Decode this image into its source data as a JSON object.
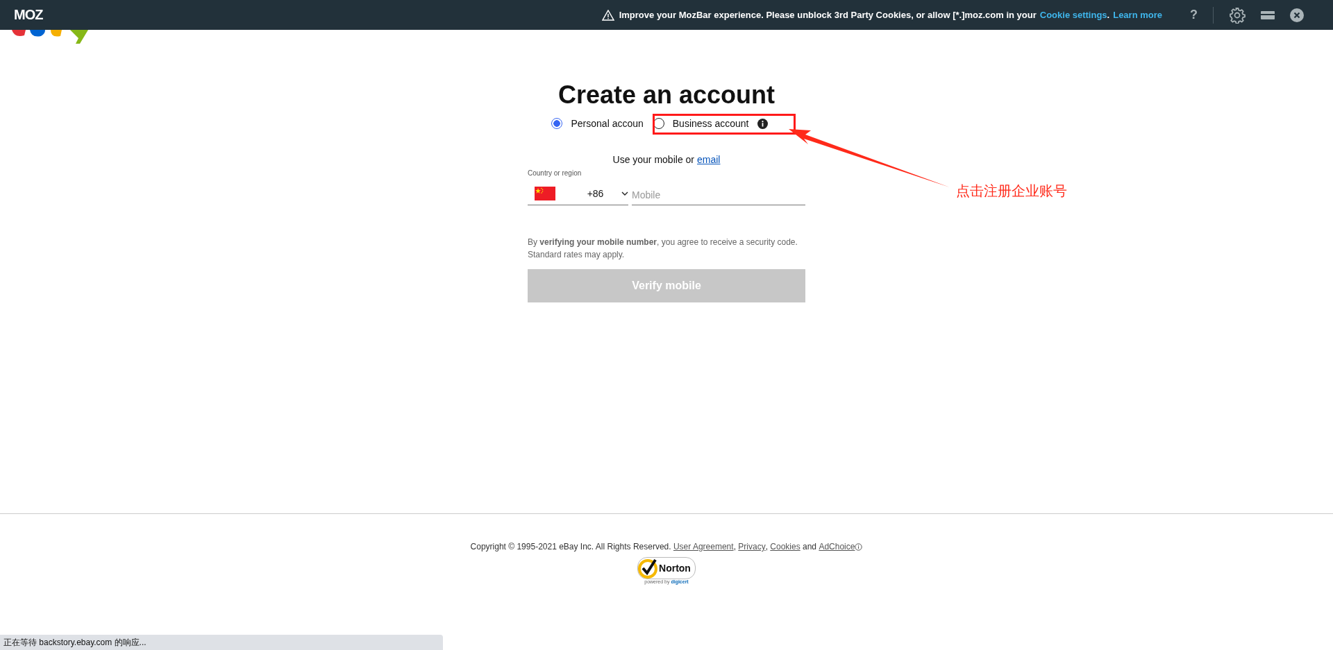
{
  "mozbar": {
    "logo": "MOZ",
    "message": "Improve your MozBar experience. Please unblock 3rd Party Cookies, or allow [*.]moz.com in your",
    "cookie_link": "Cookie settings",
    "after_link": ".",
    "learn_more": "Learn more",
    "help": "?"
  },
  "title": "Create an account",
  "account_types": [
    {
      "label": "Personal accoun",
      "selected": true,
      "info": false
    },
    {
      "label": "Business account",
      "selected": false,
      "info": true
    }
  ],
  "contact_prompt": "Use your mobile or",
  "contact_link": "email",
  "country_label": "Country or region",
  "dial_code": "+86",
  "mobile": {
    "placeholder": "Mobile"
  },
  "disclaimer": "By **verifying your mobile number**, you agree to receive a security code. Standard rates may apply.",
  "verify_button": {
    "label": "Verify mobile",
    "disabled": true
  },
  "footer": {
    "copyright": "Copyright © 1995-2021 eBay Inc. All Rights Reserved.",
    "links": [
      {
        "label": "User Agreement",
        "after": ","
      },
      {
        "label": "Privacy",
        "after": ","
      },
      {
        "label": "Cookies",
        "after": "and"
      },
      {
        "label": "AdChoice"
      }
    ],
    "seal": {
      "name": "Norton",
      "powered": "powered by",
      "brand": "digicert"
    }
  },
  "status_bar": "正在等待 backstory.ebay.com 的响应...",
  "annotation": "点击注册企业账号"
}
